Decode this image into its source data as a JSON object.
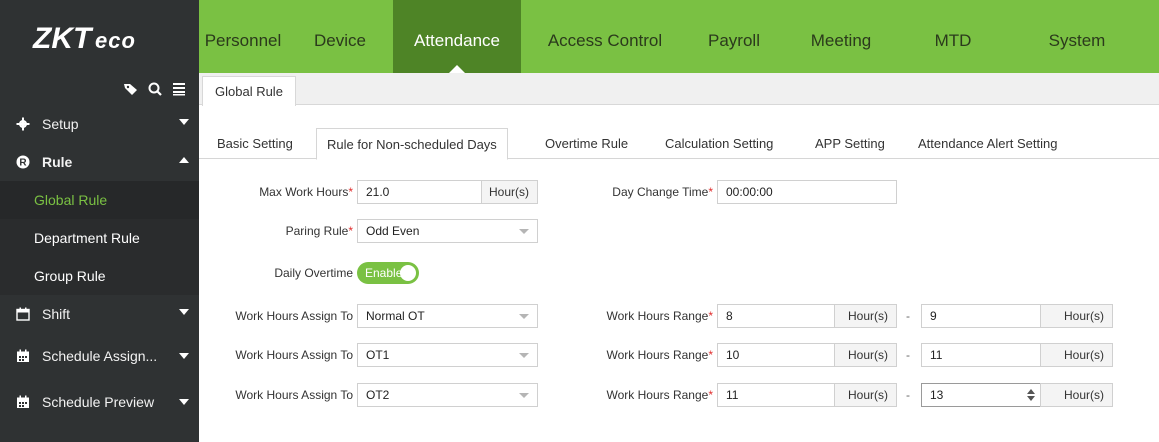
{
  "app": {
    "logo_text": "ZKTeco"
  },
  "nav": [
    {
      "label": "Personnel"
    },
    {
      "label": "Device"
    },
    {
      "label": "Attendance"
    },
    {
      "label": "Access Control"
    },
    {
      "label": "Payroll"
    },
    {
      "label": "Meeting"
    },
    {
      "label": "MTD"
    },
    {
      "label": "System"
    }
  ],
  "sidebar": {
    "groups": [
      {
        "label": "Setup"
      },
      {
        "label": "Rule"
      },
      {
        "label": "Shift"
      },
      {
        "label": "Schedule Assign..."
      },
      {
        "label": "Schedule Preview"
      }
    ],
    "rule_items": [
      {
        "label": "Global Rule"
      },
      {
        "label": "Department Rule"
      },
      {
        "label": "Group Rule"
      }
    ]
  },
  "page_tab": "Global Rule",
  "sub_tabs": [
    {
      "label": "Basic Setting"
    },
    {
      "label": "Rule for Non-scheduled Days"
    },
    {
      "label": "Overtime Rule"
    },
    {
      "label": "Calculation Setting"
    },
    {
      "label": "APP Setting"
    },
    {
      "label": "Attendance Alert Setting"
    }
  ],
  "form": {
    "max_work_hours": {
      "label": "Max Work Hours",
      "value": "21.0",
      "unit": "Hour(s)"
    },
    "day_change_time": {
      "label": "Day Change Time",
      "value": "00:00:00"
    },
    "paring_rule": {
      "label": "Paring Rule",
      "value": "Odd Even"
    },
    "daily_overtime": {
      "label": "Daily Overtime",
      "state": "Enable"
    },
    "required_mark": "*",
    "rows": [
      {
        "assign_label": "Work Hours Assign To",
        "assign_value": "Normal OT",
        "range_label": "Work Hours Range",
        "from": "8",
        "to": "9",
        "unit": "Hour(s)",
        "dash": "-"
      },
      {
        "assign_label": "Work Hours Assign To",
        "assign_value": "OT1",
        "range_label": "Work Hours Range",
        "from": "10",
        "to": "11",
        "unit": "Hour(s)",
        "dash": "-"
      },
      {
        "assign_label": "Work Hours Assign To",
        "assign_value": "OT2",
        "range_label": "Work Hours Range",
        "from": "11",
        "to": "13",
        "unit": "Hour(s)",
        "dash": "-"
      }
    ]
  },
  "colors": {
    "brand_green": "#7ac143",
    "active_nav": "#4e8426",
    "sidebar_bg": "#2f3233"
  }
}
